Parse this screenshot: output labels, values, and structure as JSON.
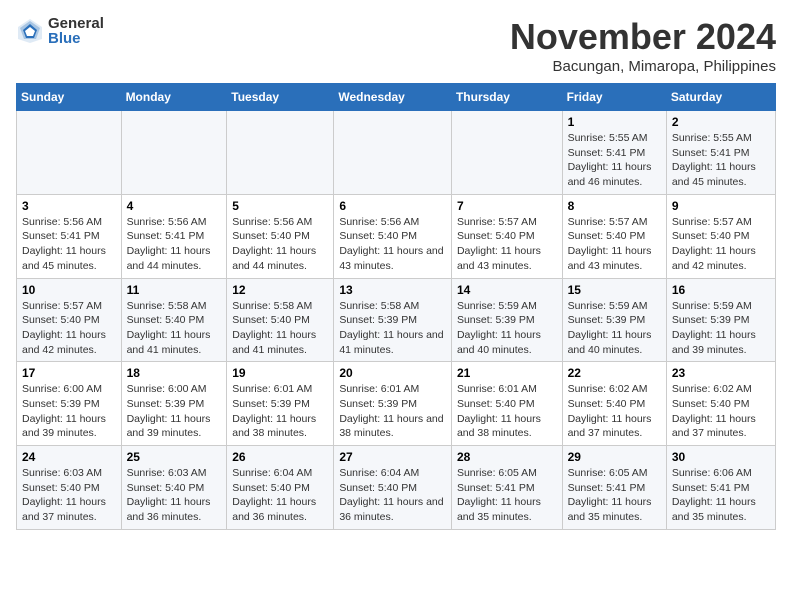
{
  "logo": {
    "general": "General",
    "blue": "Blue"
  },
  "title": "November 2024",
  "location": "Bacungan, Mimaropa, Philippines",
  "days_of_week": [
    "Sunday",
    "Monday",
    "Tuesday",
    "Wednesday",
    "Thursday",
    "Friday",
    "Saturday"
  ],
  "weeks": [
    [
      {
        "day": "",
        "info": ""
      },
      {
        "day": "",
        "info": ""
      },
      {
        "day": "",
        "info": ""
      },
      {
        "day": "",
        "info": ""
      },
      {
        "day": "",
        "info": ""
      },
      {
        "day": "1",
        "info": "Sunrise: 5:55 AM\nSunset: 5:41 PM\nDaylight: 11 hours and 46 minutes."
      },
      {
        "day": "2",
        "info": "Sunrise: 5:55 AM\nSunset: 5:41 PM\nDaylight: 11 hours and 45 minutes."
      }
    ],
    [
      {
        "day": "3",
        "info": "Sunrise: 5:56 AM\nSunset: 5:41 PM\nDaylight: 11 hours and 45 minutes."
      },
      {
        "day": "4",
        "info": "Sunrise: 5:56 AM\nSunset: 5:41 PM\nDaylight: 11 hours and 44 minutes."
      },
      {
        "day": "5",
        "info": "Sunrise: 5:56 AM\nSunset: 5:40 PM\nDaylight: 11 hours and 44 minutes."
      },
      {
        "day": "6",
        "info": "Sunrise: 5:56 AM\nSunset: 5:40 PM\nDaylight: 11 hours and 43 minutes."
      },
      {
        "day": "7",
        "info": "Sunrise: 5:57 AM\nSunset: 5:40 PM\nDaylight: 11 hours and 43 minutes."
      },
      {
        "day": "8",
        "info": "Sunrise: 5:57 AM\nSunset: 5:40 PM\nDaylight: 11 hours and 43 minutes."
      },
      {
        "day": "9",
        "info": "Sunrise: 5:57 AM\nSunset: 5:40 PM\nDaylight: 11 hours and 42 minutes."
      }
    ],
    [
      {
        "day": "10",
        "info": "Sunrise: 5:57 AM\nSunset: 5:40 PM\nDaylight: 11 hours and 42 minutes."
      },
      {
        "day": "11",
        "info": "Sunrise: 5:58 AM\nSunset: 5:40 PM\nDaylight: 11 hours and 41 minutes."
      },
      {
        "day": "12",
        "info": "Sunrise: 5:58 AM\nSunset: 5:40 PM\nDaylight: 11 hours and 41 minutes."
      },
      {
        "day": "13",
        "info": "Sunrise: 5:58 AM\nSunset: 5:39 PM\nDaylight: 11 hours and 41 minutes."
      },
      {
        "day": "14",
        "info": "Sunrise: 5:59 AM\nSunset: 5:39 PM\nDaylight: 11 hours and 40 minutes."
      },
      {
        "day": "15",
        "info": "Sunrise: 5:59 AM\nSunset: 5:39 PM\nDaylight: 11 hours and 40 minutes."
      },
      {
        "day": "16",
        "info": "Sunrise: 5:59 AM\nSunset: 5:39 PM\nDaylight: 11 hours and 39 minutes."
      }
    ],
    [
      {
        "day": "17",
        "info": "Sunrise: 6:00 AM\nSunset: 5:39 PM\nDaylight: 11 hours and 39 minutes."
      },
      {
        "day": "18",
        "info": "Sunrise: 6:00 AM\nSunset: 5:39 PM\nDaylight: 11 hours and 39 minutes."
      },
      {
        "day": "19",
        "info": "Sunrise: 6:01 AM\nSunset: 5:39 PM\nDaylight: 11 hours and 38 minutes."
      },
      {
        "day": "20",
        "info": "Sunrise: 6:01 AM\nSunset: 5:39 PM\nDaylight: 11 hours and 38 minutes."
      },
      {
        "day": "21",
        "info": "Sunrise: 6:01 AM\nSunset: 5:40 PM\nDaylight: 11 hours and 38 minutes."
      },
      {
        "day": "22",
        "info": "Sunrise: 6:02 AM\nSunset: 5:40 PM\nDaylight: 11 hours and 37 minutes."
      },
      {
        "day": "23",
        "info": "Sunrise: 6:02 AM\nSunset: 5:40 PM\nDaylight: 11 hours and 37 minutes."
      }
    ],
    [
      {
        "day": "24",
        "info": "Sunrise: 6:03 AM\nSunset: 5:40 PM\nDaylight: 11 hours and 37 minutes."
      },
      {
        "day": "25",
        "info": "Sunrise: 6:03 AM\nSunset: 5:40 PM\nDaylight: 11 hours and 36 minutes."
      },
      {
        "day": "26",
        "info": "Sunrise: 6:04 AM\nSunset: 5:40 PM\nDaylight: 11 hours and 36 minutes."
      },
      {
        "day": "27",
        "info": "Sunrise: 6:04 AM\nSunset: 5:40 PM\nDaylight: 11 hours and 36 minutes."
      },
      {
        "day": "28",
        "info": "Sunrise: 6:05 AM\nSunset: 5:41 PM\nDaylight: 11 hours and 35 minutes."
      },
      {
        "day": "29",
        "info": "Sunrise: 6:05 AM\nSunset: 5:41 PM\nDaylight: 11 hours and 35 minutes."
      },
      {
        "day": "30",
        "info": "Sunrise: 6:06 AM\nSunset: 5:41 PM\nDaylight: 11 hours and 35 minutes."
      }
    ]
  ]
}
